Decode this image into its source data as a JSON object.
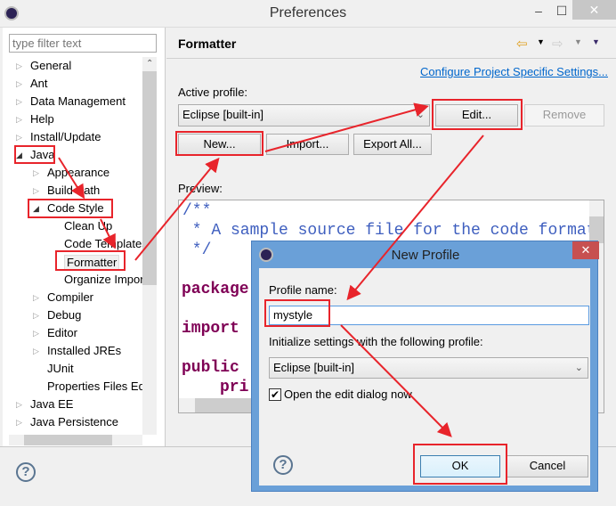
{
  "window": {
    "title": "Preferences",
    "icon": "eclipse-icon",
    "minimize": "–",
    "maximize": "☐",
    "close": "✕"
  },
  "sidebar": {
    "filter_placeholder": "type filter text",
    "items": [
      {
        "label": "General",
        "level": 0,
        "expanded": false
      },
      {
        "label": "Ant",
        "level": 0,
        "expanded": false
      },
      {
        "label": "Data Management",
        "level": 0,
        "expanded": false
      },
      {
        "label": "Help",
        "level": 0,
        "expanded": false
      },
      {
        "label": "Install/Update",
        "level": 0,
        "expanded": false
      },
      {
        "label": "Java",
        "level": 0,
        "expanded": true
      },
      {
        "label": "Appearance",
        "level": 1,
        "expanded": false
      },
      {
        "label": "Build Path",
        "level": 1,
        "expanded": false
      },
      {
        "label": "Code Style",
        "level": 1,
        "expanded": true
      },
      {
        "label": "Clean Up",
        "level": 2
      },
      {
        "label": "Code Templates",
        "level": 2
      },
      {
        "label": "Formatter",
        "level": 2,
        "selected": true
      },
      {
        "label": "Organize Imports",
        "level": 2
      },
      {
        "label": "Compiler",
        "level": 1,
        "expanded": false
      },
      {
        "label": "Debug",
        "level": 1,
        "expanded": false
      },
      {
        "label": "Editor",
        "level": 1,
        "expanded": false
      },
      {
        "label": "Installed JREs",
        "level": 1,
        "expanded": false
      },
      {
        "label": "JUnit",
        "level": 1
      },
      {
        "label": "Properties Files Editor",
        "level": 1
      },
      {
        "label": "Java EE",
        "level": 0,
        "expanded": false
      },
      {
        "label": "Java Persistence",
        "level": 0,
        "expanded": false
      }
    ]
  },
  "main": {
    "title": "Formatter",
    "configure_link": "Configure Project Specific Settings...",
    "active_profile_label": "Active profile:",
    "active_profile_value": "Eclipse [built-in]",
    "edit": "Edit...",
    "remove": "Remove",
    "new": "New...",
    "import": "Import...",
    "export_all": "Export All...",
    "preview_label": "Preview:",
    "code": {
      "c1": "/**",
      "c2": " * A sample source file for the code formatter preview",
      "c3": " */",
      "k1": "package",
      "k2": "import",
      "k3": "public",
      "k4": "pri"
    }
  },
  "help_icon": "?",
  "dialog": {
    "title": "New Profile",
    "close": "✕",
    "profile_name_label": "Profile name:",
    "profile_name_value": "mystyle",
    "init_label": "Initialize settings with the following profile:",
    "init_value": "Eclipse [built-in]",
    "open_edit_label": "Open the edit dialog now",
    "open_edit_checked": true,
    "ok": "OK",
    "cancel": "Cancel"
  },
  "colors": {
    "annotation": "#e8242b",
    "dialog_frame": "#6aa0d8",
    "link": "#0066cc",
    "comment": "#3f5fbf",
    "keyword": "#7f0055"
  }
}
